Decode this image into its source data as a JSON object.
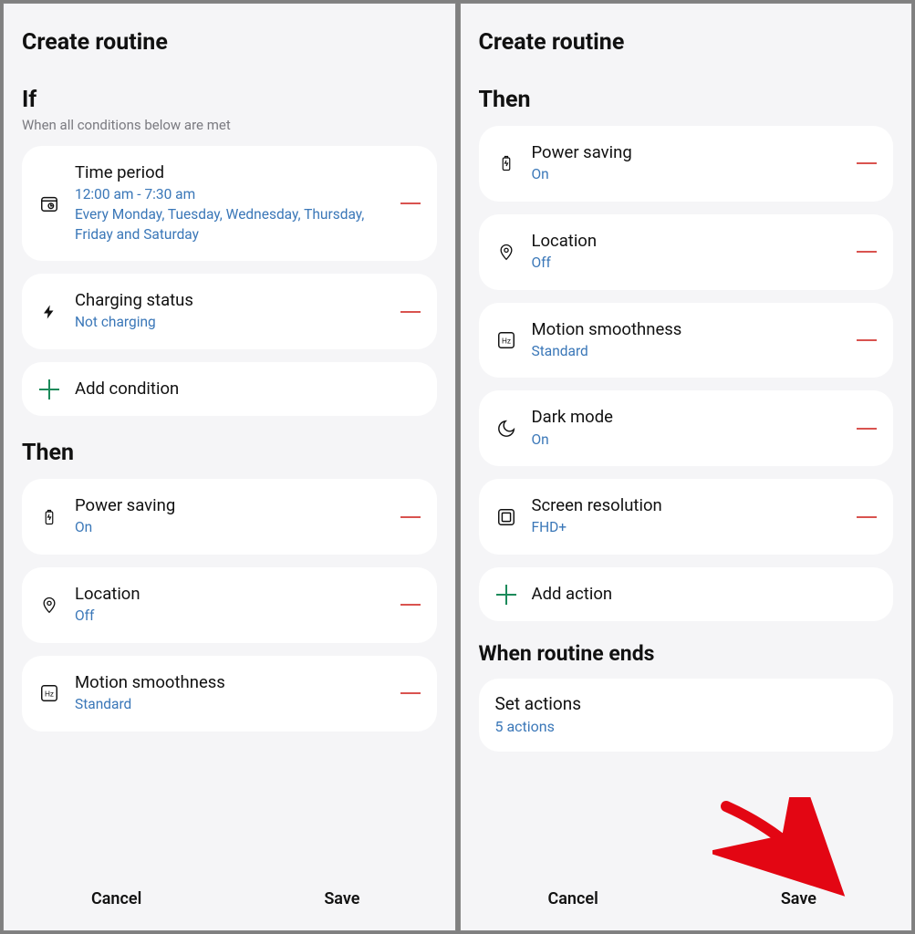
{
  "left": {
    "title": "Create routine",
    "if_heading": "If",
    "if_sub": "When all conditions below are met",
    "conditions": [
      {
        "icon": "calendar",
        "label": "Time period",
        "value": "12:00  am - 7:30  am\nEvery Monday, Tuesday, Wednesday, Thursday, Friday and Saturday"
      },
      {
        "icon": "bolt",
        "label": "Charging status",
        "value": "Not charging"
      }
    ],
    "add_condition": "Add condition",
    "then_heading": "Then",
    "actions": [
      {
        "icon": "battery",
        "label": "Power saving",
        "value": "On"
      },
      {
        "icon": "pin",
        "label": "Location",
        "value": "Off"
      },
      {
        "icon": "hz",
        "label": "Motion smoothness",
        "value": "Standard"
      }
    ],
    "cancel": "Cancel",
    "save": "Save"
  },
  "right": {
    "title": "Create routine",
    "then_heading": "Then",
    "actions": [
      {
        "icon": "battery",
        "label": "Power saving",
        "value": "On"
      },
      {
        "icon": "pin",
        "label": "Location",
        "value": "Off"
      },
      {
        "icon": "hz",
        "label": "Motion smoothness",
        "value": "Standard"
      },
      {
        "icon": "moon",
        "label": "Dark mode",
        "value": "On"
      },
      {
        "icon": "resolution",
        "label": "Screen resolution",
        "value": "FHD+"
      }
    ],
    "add_action": "Add action",
    "ends_heading": "When routine ends",
    "set_actions_label": "Set actions",
    "set_actions_value": "5 actions",
    "cancel": "Cancel",
    "save": "Save"
  }
}
